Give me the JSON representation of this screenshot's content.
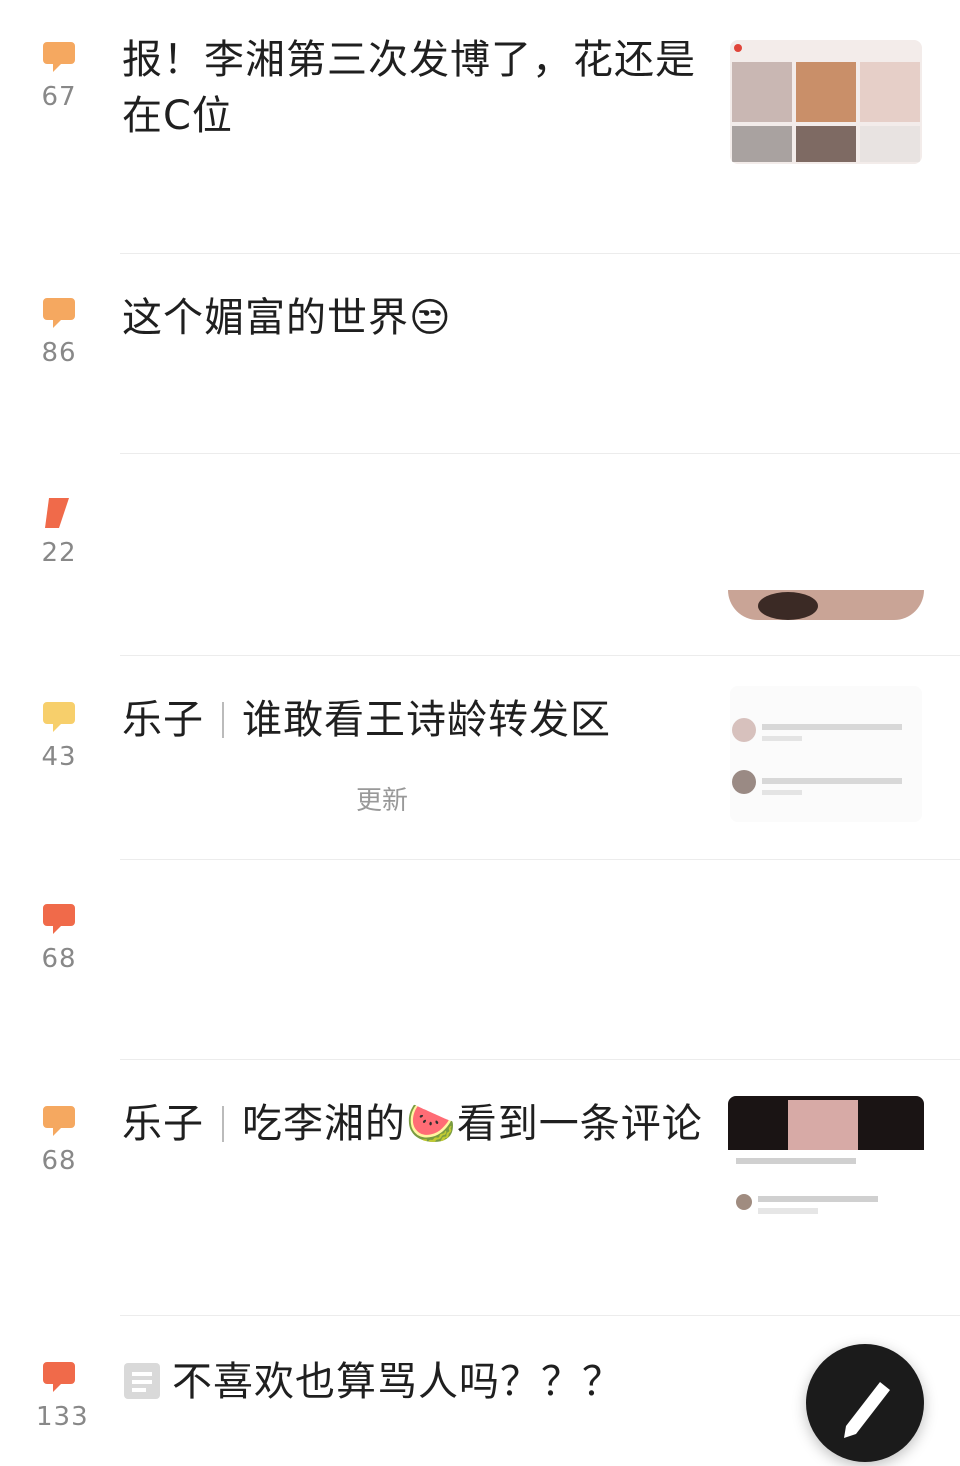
{
  "colors": {
    "hot": "#f06a4a",
    "warm": "#f5a860",
    "mild": "#f7cf6b",
    "text": "#1f1f1f",
    "muted": "#999999"
  },
  "posts": [
    {
      "count": "67",
      "title": "报！李湘第三次发博了，花还是在C位"
    },
    {
      "count": "86",
      "title": "这个媚富的世界😒"
    },
    {
      "count": "22"
    },
    {
      "count": "43",
      "tag": "乐子",
      "title": "谁敢看王诗龄转发区",
      "meta": "更新"
    },
    {
      "count": "68"
    },
    {
      "count": "68",
      "tag": "乐子",
      "title": "吃李湘的🍉看到一条评论"
    },
    {
      "count": "133",
      "title": "不喜欢也算骂人吗？？？"
    }
  ],
  "fab": {
    "icon": "pencil-icon"
  }
}
